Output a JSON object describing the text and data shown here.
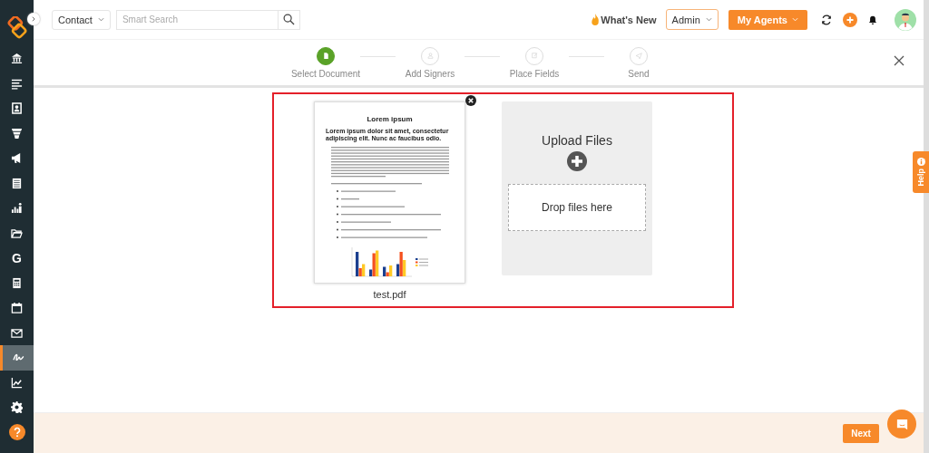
{
  "sidebar": {
    "items": [
      {
        "kind": "bank",
        "selected": false
      },
      {
        "kind": "list",
        "selected": false
      },
      {
        "kind": "contact",
        "selected": false
      },
      {
        "kind": "funnel",
        "selected": false
      },
      {
        "kind": "megaphone",
        "selected": false
      },
      {
        "kind": "sheet",
        "selected": false
      },
      {
        "kind": "people-chart",
        "selected": false
      },
      {
        "kind": "folder",
        "selected": false
      },
      {
        "kind": "letter",
        "glyph": "G",
        "selected": false
      },
      {
        "kind": "calculator",
        "selected": false
      },
      {
        "kind": "calendar",
        "selected": false
      },
      {
        "kind": "mail",
        "selected": false
      },
      {
        "kind": "signature",
        "selected": true
      },
      {
        "kind": "line-chart",
        "selected": false
      },
      {
        "kind": "gear",
        "selected": false
      },
      {
        "kind": "help",
        "selected": false
      }
    ]
  },
  "topbar": {
    "module": "Contact",
    "search": {
      "placeholder": "Smart Search"
    },
    "whats_new": "What's New",
    "role": "Admin",
    "agents": "My Agents"
  },
  "steps": [
    {
      "label": "Select Document",
      "selected": true
    },
    {
      "label": "Add Signers",
      "selected": false
    },
    {
      "label": "Place Fields",
      "selected": false
    },
    {
      "label": "Send",
      "selected": false
    }
  ],
  "document": {
    "title": "Lorem ipsum",
    "subtitle": "Lorem ipsum dolor sit amet, consectetur adipiscing elit. Nunc ac faucibus odio.",
    "filename": "test.pdf"
  },
  "upload": {
    "title": "Upload Files",
    "drop": "Drop files here"
  },
  "help_tab": "Help",
  "footer": {
    "next": "Next"
  }
}
